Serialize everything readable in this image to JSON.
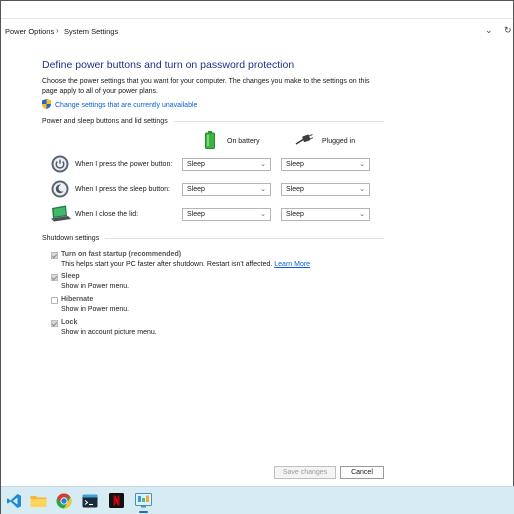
{
  "breadcrumb": {
    "items": [
      "Power Options",
      "System Settings"
    ],
    "separator": ">"
  },
  "header": {
    "title": "Define power buttons and turn on password protection",
    "description": "Choose the power settings that you want for your computer. The changes you make to the settings on this page apply to all of your power plans.",
    "admin_link": "Change settings that are currently unavailable"
  },
  "power_section": {
    "heading": "Power and sleep buttons and lid settings",
    "col_battery": "On battery",
    "col_plugged": "Plugged in",
    "rows": [
      {
        "label": "When I press the power button:",
        "battery": "Sleep",
        "plugged": "Sleep"
      },
      {
        "label": "When I press the sleep button:",
        "battery": "Sleep",
        "plugged": "Sleep"
      },
      {
        "label": "When I close the lid:",
        "battery": "Sleep",
        "plugged": "Sleep"
      }
    ]
  },
  "shutdown_section": {
    "heading": "Shutdown settings",
    "items": [
      {
        "label": "Turn on fast startup (recommended)",
        "sub": "This helps start your PC faster after shutdown. Restart isn't affected.",
        "link": "Learn More",
        "checked": true
      },
      {
        "label": "Sleep",
        "sub": "Show in Power menu.",
        "checked": true
      },
      {
        "label": "Hibernate",
        "sub": "Show in Power menu.",
        "checked": false
      },
      {
        "label": "Lock",
        "sub": "Show in account picture menu.",
        "checked": true
      }
    ]
  },
  "footer": {
    "save_label": "Save changes",
    "cancel_label": "Cancel"
  },
  "taskbar": {
    "icons": [
      "vscode-icon",
      "file-explorer-icon",
      "chrome-icon",
      "terminal-icon",
      "netflix-icon",
      "control-panel-icon"
    ]
  },
  "colors": {
    "title": "#1e3287",
    "link": "#0b5fd3",
    "taskbar": "#d7ecf2"
  }
}
